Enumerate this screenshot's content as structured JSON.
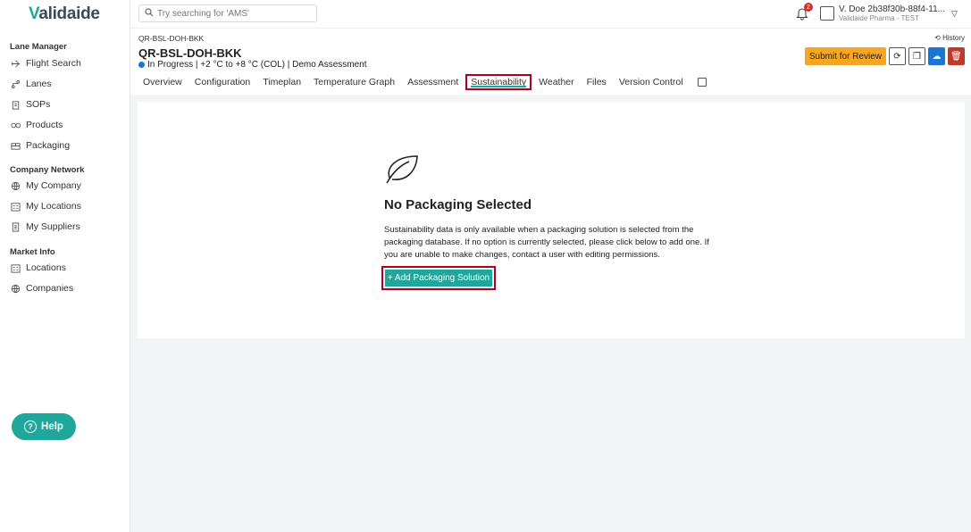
{
  "app": {
    "logo": "Validaide",
    "logo_first": "V",
    "logo_rest": "alidaide"
  },
  "search": {
    "placeholder": "Try searching for 'AMS'"
  },
  "notifications": {
    "count": "2"
  },
  "user": {
    "name": "V. Doe 2b38f30b-88f4-11...",
    "org": "Validaide Pharma - TEST"
  },
  "sidebar": {
    "sections": [
      {
        "title": "Lane Manager",
        "items": [
          {
            "label": "Flight Search",
            "icon": "plane-icon"
          },
          {
            "label": "Lanes",
            "icon": "route-icon"
          },
          {
            "label": "SOPs",
            "icon": "clipboard-icon"
          },
          {
            "label": "Products",
            "icon": "pills-icon"
          },
          {
            "label": "Packaging",
            "icon": "box-icon"
          }
        ]
      },
      {
        "title": "Company Network",
        "items": [
          {
            "label": "My Company",
            "icon": "globe-icon"
          },
          {
            "label": "My Locations",
            "icon": "building-icon"
          },
          {
            "label": "My Suppliers",
            "icon": "building-list-icon"
          }
        ]
      },
      {
        "title": "Market Info",
        "items": [
          {
            "label": "Locations",
            "icon": "building-icon"
          },
          {
            "label": "Companies",
            "icon": "globe-icon"
          }
        ]
      }
    ],
    "help": "Help"
  },
  "header": {
    "breadcrumb": "QR-BSL-DOH-BKK",
    "title": "QR-BSL-DOH-BKK",
    "status": "In Progress | +2 °C to +8 °C (COL) | Demo Assessment",
    "status_color": "#1976d2",
    "history": "History",
    "submit": "Submit for Review"
  },
  "tabs": [
    "Overview",
    "Configuration",
    "Timeplan",
    "Temperature Graph",
    "Assessment",
    "Sustainability",
    "Weather",
    "Files",
    "Version Control"
  ],
  "active_tab": "Sustainability",
  "empty_state": {
    "title": "No Packaging Selected",
    "text": "Sustainability data is only available when a packaging solution is selected from the packaging database. If no option is currently selected, please click below to add one. If you are unable to make changes, contact a user with editing permissions.",
    "button": "+ Add Packaging Solution"
  },
  "colors": {
    "accent": "#1ea79a",
    "highlight": "#b00020",
    "review": "#f5a623",
    "delete": "#c0392b",
    "cloud": "#1976d2"
  }
}
